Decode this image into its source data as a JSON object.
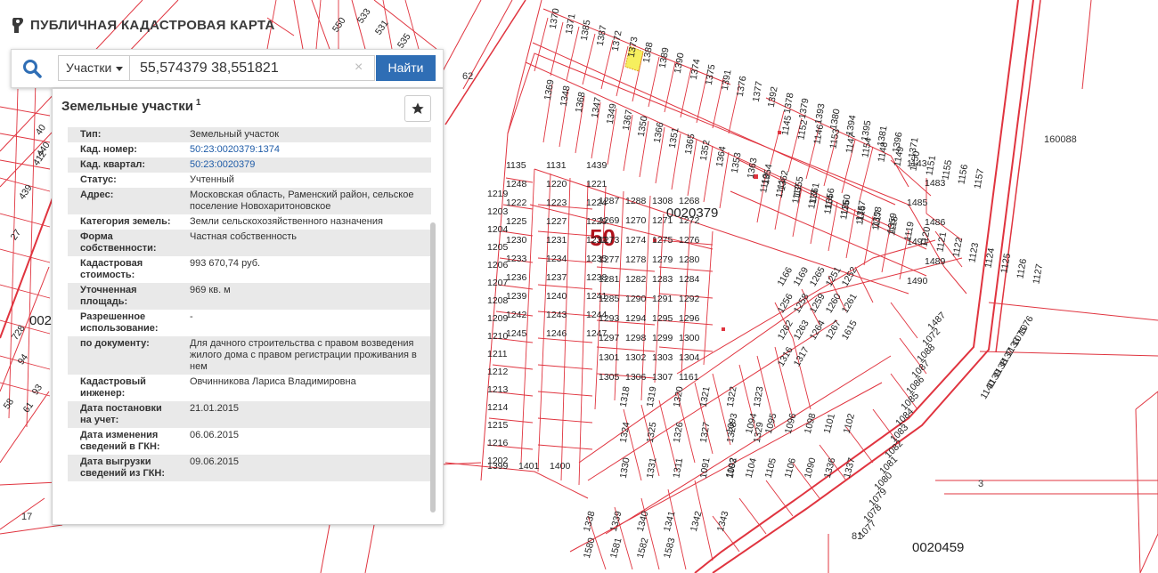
{
  "app": {
    "title": "ПУБЛИЧНАЯ КАДАСТРОВАЯ КАРТА"
  },
  "search": {
    "type_label": "Участки",
    "query": "55,574379 38,551821",
    "clear_glyph": "×",
    "submit_label": "Найти"
  },
  "panel": {
    "title": "Земельные участки",
    "count": "1",
    "rows": [
      {
        "key": "Тип:",
        "value": "Земельный участок",
        "link": false
      },
      {
        "key": "Кад. номер:",
        "value": "50:23:0020379:1374",
        "link": true
      },
      {
        "key": "Кад. квартал:",
        "value": "50:23:0020379",
        "link": true
      },
      {
        "key": "Статус:",
        "value": "Учтенный",
        "link": false
      },
      {
        "key": "Адрес:",
        "value": "Московская область, Раменский район, сельское поселение Новохаритоновское",
        "link": false
      },
      {
        "key": "Категория земель:",
        "value": "Земли сельскохозяйственного назначения",
        "link": false
      },
      {
        "key": "Форма собственности:",
        "value": "Частная собственность",
        "link": false
      },
      {
        "key": "Кадастровая стоимость:",
        "value": "993 670,74 руб.",
        "link": false
      },
      {
        "key": "Уточненная площадь:",
        "value": "969 кв. м",
        "link": false
      },
      {
        "key": "Разрешенное использование:",
        "value": "-",
        "link": false
      },
      {
        "key": "по документу:",
        "value": "Для дачного строительства с правом возведения жилого дома с правом регистрации проживания в нем",
        "link": false
      },
      {
        "key": "Кадастровый инженер:",
        "value": "Овчинникова Лариса Владимировна",
        "link": false
      },
      {
        "key": "Дата постановки на учет:",
        "value": "21.01.2015",
        "link": false
      },
      {
        "key": "Дата изменения сведений в ГКН:",
        "value": "06.06.2015",
        "link": false
      },
      {
        "key": "Дата выгрузки сведений из ГКН:",
        "value": "09.06.2015",
        "link": false
      }
    ]
  },
  "map": {
    "region_label": "50",
    "quarter_label": "0020379",
    "quarter_label_2": "0020459",
    "quarter_label_3": "160088",
    "misc_labels": [
      "62",
      "3",
      "81",
      "17",
      "002"
    ],
    "parcels": [
      "1370",
      "1371",
      "1385",
      "1387",
      "1372",
      "1373",
      "1388",
      "1389",
      "1390",
      "1374",
      "1375",
      "1391",
      "1376",
      "1377",
      "1392",
      "1378",
      "1379",
      "1393",
      "1380",
      "1394",
      "1395",
      "1381",
      "1396",
      "1371",
      "1369",
      "1348",
      "1368",
      "1347",
      "1349",
      "1367",
      "1350",
      "1366",
      "1351",
      "1365",
      "1352",
      "1364",
      "1353",
      "1363",
      "1354",
      "1362",
      "1355",
      "1361",
      "1356",
      "1360",
      "1357",
      "1358",
      "1359",
      "1145",
      "1152",
      "1146",
      "1153",
      "1147",
      "1154",
      "1148",
      "1149",
      "1150",
      "1151",
      "1155",
      "1156",
      "1157",
      "1110",
      "1111",
      "1112",
      "1113",
      "1114",
      "1115",
      "1116",
      "1117",
      "1118",
      "1119",
      "1120",
      "1121",
      "1122",
      "1123",
      "1124",
      "1125",
      "1126",
      "1127",
      "1143",
      "1483",
      "1485",
      "1486",
      "1491",
      "1489",
      "1490",
      "1487",
      "1072",
      "1088",
      "1087",
      "1086",
      "1085",
      "1084",
      "1083",
      "1082",
      "1081",
      "1080",
      "1079",
      "1078",
      "1077",
      "1076",
      "1075",
      "1133",
      "1137",
      "1138",
      "1139",
      "1140",
      "1135",
      "1131",
      "1439",
      "1248",
      "1220",
      "1221",
      "1222",
      "1223",
      "1224",
      "1225",
      "1227",
      "1229",
      "1230",
      "1231",
      "1232",
      "1233",
      "1234",
      "1235",
      "1236",
      "1237",
      "1238",
      "1239",
      "1240",
      "1241",
      "1242",
      "1243",
      "1244",
      "1245",
      "1246",
      "1247",
      "1219",
      "1203",
      "1204",
      "1205",
      "1206",
      "1207",
      "1208",
      "1209",
      "1210",
      "1211",
      "1212",
      "1213",
      "1214",
      "1215",
      "1216",
      "1202",
      "1399",
      "1401",
      "1400",
      "1287",
      "1288",
      "1308",
      "1268",
      "1269",
      "1270",
      "1271",
      "1272",
      "1273",
      "1274",
      "1275",
      "1276",
      "1277",
      "1278",
      "1279",
      "1280",
      "1281",
      "1282",
      "1283",
      "1284",
      "1285",
      "1290",
      "1291",
      "1292",
      "1293",
      "1294",
      "1295",
      "1296",
      "1297",
      "1298",
      "1299",
      "1300",
      "1301",
      "1302",
      "1303",
      "1304",
      "1305",
      "1306",
      "1307",
      "1161",
      "1166",
      "1169",
      "1265",
      "1251",
      "1252",
      "1256",
      "1258",
      "1259",
      "1260",
      "1261",
      "1262",
      "1263",
      "1264",
      "1267",
      "1615",
      "1316",
      "1317",
      "1318",
      "1319",
      "1320",
      "1321",
      "1322",
      "1323",
      "1324",
      "1325",
      "1326",
      "1327",
      "1328",
      "1329",
      "1330",
      "1331",
      "1311",
      "1091",
      "1092",
      "1093",
      "1094",
      "1095",
      "1096",
      "1098",
      "1101",
      "1102",
      "1103",
      "1104",
      "1105",
      "1106",
      "1090",
      "1336",
      "1337",
      "1338",
      "1339",
      "1340",
      "1341",
      "1342",
      "1343",
      "1580",
      "1581",
      "1582",
      "1583"
    ],
    "left_parcels": [
      "533",
      "531",
      "550",
      "535",
      "439",
      "440",
      "412",
      "40",
      "27",
      "93",
      "94",
      "58",
      "61",
      "728"
    ]
  }
}
